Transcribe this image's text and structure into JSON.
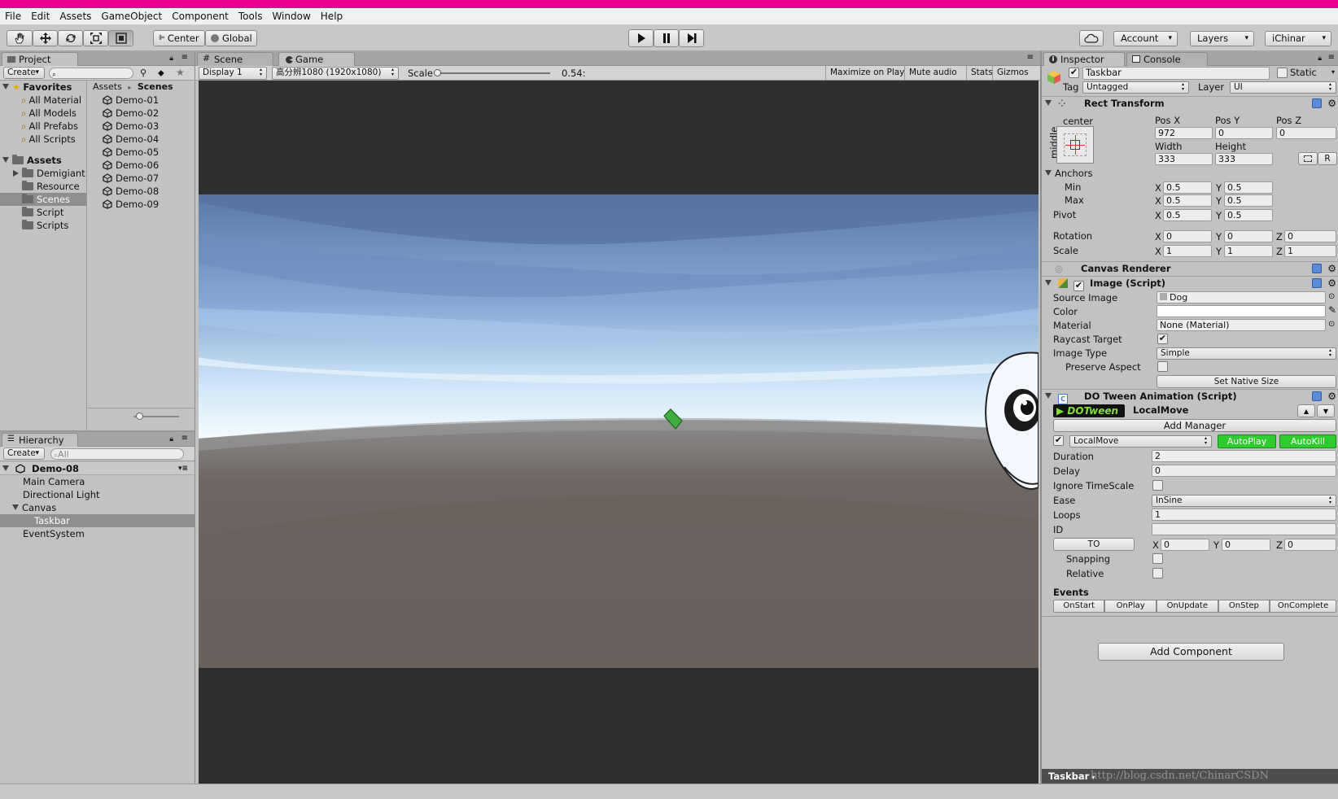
{
  "menu": [
    "File",
    "Edit",
    "Assets",
    "GameObject",
    "Component",
    "Tools",
    "Window",
    "Help"
  ],
  "toolbar": {
    "pivot_label": "Center",
    "space_label": "Global",
    "account": "Account",
    "layers": "Layers",
    "layout": "iChinar"
  },
  "project": {
    "tab": "Project",
    "create": "Create",
    "favorites_title": "Favorites",
    "favorites": [
      "All Material",
      "All Models",
      "All Prefabs",
      "All Scripts"
    ],
    "assets_title": "Assets",
    "assets": [
      "Demigiant",
      "Resource",
      "Scenes",
      "Script",
      "Scripts"
    ],
    "breadcrumb": [
      "Assets",
      "Scenes"
    ],
    "scenes": [
      "Demo-01",
      "Demo-02",
      "Demo-03",
      "Demo-04",
      "Demo-05",
      "Demo-06",
      "Demo-07",
      "Demo-08",
      "Demo-09"
    ]
  },
  "hierarchy": {
    "tab": "Hierarchy",
    "create": "Create",
    "search_placeholder": "All",
    "scene": "Demo-08",
    "items": [
      "Main Camera",
      "Directional Light",
      "Canvas",
      "Taskbar",
      "EventSystem"
    ]
  },
  "view": {
    "scene_tab": "Scene",
    "game_tab": "Game",
    "display": "Display 1",
    "resolution": "高分辨1080 (1920x1080)",
    "scale_label": "Scale",
    "scale_value": "0.54:",
    "scale_level": 0.0,
    "maximize": "Maximize on Play",
    "mute": "Mute audio",
    "stats": "Stats",
    "gizmos": "Gizmos"
  },
  "inspector": {
    "tab": "Inspector",
    "console_tab": "Console",
    "object_name": "Taskbar",
    "static_label": "Static",
    "tag_label": "Tag",
    "tag_value": "Untagged",
    "layer_label": "Layer",
    "layer_value": "UI",
    "rect": {
      "title": "Rect Transform",
      "anchor_h": "center",
      "anchor_v": "middle",
      "posx_label": "Pos X",
      "posy_label": "Pos Y",
      "posz_label": "Pos Z",
      "posx": "972",
      "posy": "0",
      "posz": "0",
      "width_label": "Width",
      "height_label": "Height",
      "width": "333",
      "height": "333",
      "r_btn": "R",
      "anchors_label": "Anchors",
      "min_label": "Min",
      "max_label": "Max",
      "pivot_label": "Pivot",
      "min_x": "0.5",
      "min_y": "0.5",
      "max_x": "0.5",
      "max_y": "0.5",
      "pivot_x": "0.5",
      "pivot_y": "0.5",
      "rotation_label": "Rotation",
      "scale_label": "Scale",
      "rot_x": "0",
      "rot_y": "0",
      "rot_z": "0",
      "scale_x": "1",
      "scale_y": "1",
      "scale_z": "1",
      "x": "X",
      "y": "Y",
      "z": "Z"
    },
    "canvas_renderer": "Canvas Renderer",
    "image": {
      "title": "Image (Script)",
      "source_label": "Source Image",
      "source": "Dog",
      "color_label": "Color",
      "material_label": "Material",
      "material": "None (Material)",
      "raycast_label": "Raycast Target",
      "type_label": "Image Type",
      "type": "Simple",
      "preserve_label": "Preserve Aspect",
      "native_btn": "Set Native Size"
    },
    "dotween": {
      "title": "DO Tween Animation (Script)",
      "logo": "DOTween",
      "anim_name": "LocalMove",
      "add_manager": "Add Manager",
      "anim_type": "LocalMove",
      "autoplay": "AutoPlay",
      "autokill": "AutoKill",
      "duration_label": "Duration",
      "duration": "2",
      "delay_label": "Delay",
      "delay": "0",
      "ignore_label": "Ignore TimeScale",
      "ease_label": "Ease",
      "ease": "InSine",
      "loops_label": "Loops",
      "loops": "1",
      "id_label": "ID",
      "id": "",
      "to_btn": "TO",
      "to_x": "0",
      "to_y": "0",
      "to_z": "0",
      "snapping_label": "Snapping",
      "relative_label": "Relative",
      "events_label": "Events",
      "events": [
        "OnStart",
        "OnPlay",
        "OnUpdate",
        "OnStep",
        "OnComplete"
      ]
    },
    "add_component": "Add Component",
    "footer": "Taskbar",
    "watermark": "http://blog.csdn.net/ChinarCSDN"
  },
  "colors": {
    "accent": "#e8008c",
    "autoplay": "#2ecc2e",
    "selection": "#8e8e8e"
  }
}
